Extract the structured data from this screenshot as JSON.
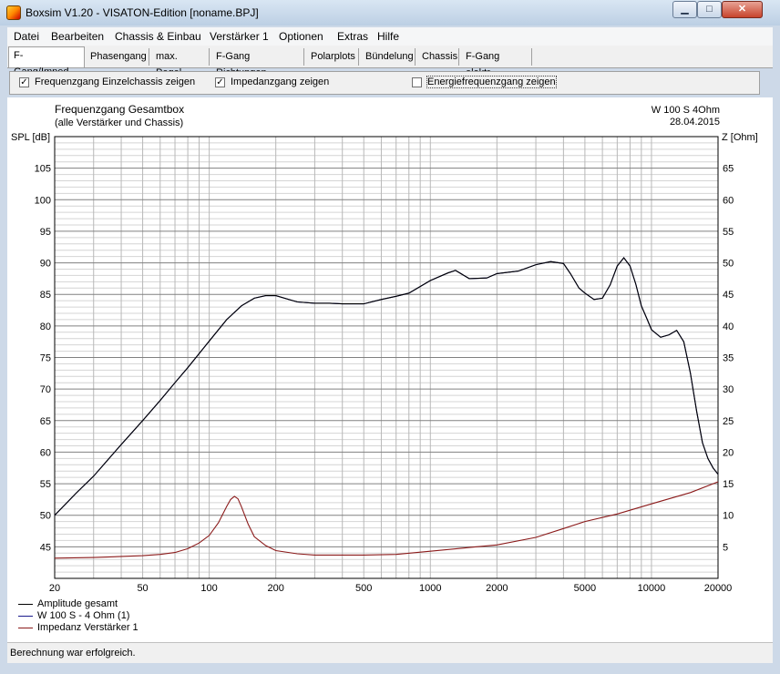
{
  "window": {
    "title": "Boxsim V1.20 - VISATON-Edition [noname.BPJ]"
  },
  "menu": [
    "Datei",
    "Bearbeiten",
    "Chassis & Einbau",
    "Verstärker 1",
    "Optionen",
    "Extras",
    "Hilfe"
  ],
  "tabs": [
    "F-Gang/Imped.",
    "Phasengang",
    "max. Pegel",
    "F-Gang Richtungen",
    "Polarplots",
    "Bündelung",
    "Chassis",
    "F-Gang elektr."
  ],
  "options": [
    {
      "label": "Frequenzgang Einzelchassis zeigen",
      "checked": true
    },
    {
      "label": "Impedanzgang zeigen",
      "checked": true
    },
    {
      "label": "Energiefrequenzgang zeigen",
      "checked": false
    }
  ],
  "status": "Berechnung war erfolgreich.",
  "colors": {
    "amplitude": "#000000",
    "chassis": "#1a1a8c",
    "impedance": "#8b1a1a"
  },
  "chart_data": {
    "type": "line",
    "title": "Frequenzgang Gesamtbox",
    "subtitle": "(alle Verstärker und Chassis)",
    "model": "W 100 S 4Ohm",
    "date": "28.04.2015",
    "ylabel": "SPL [dB]",
    "y2label": "Z [Ohm]",
    "xscale": "log",
    "xlim": [
      20,
      20000
    ],
    "ylim": [
      40,
      110
    ],
    "y2lim": [
      0,
      70
    ],
    "x_ticks": [
      "20",
      "50",
      "100",
      "200",
      "500",
      "1000",
      "2000",
      "5000",
      "10000",
      "20000"
    ],
    "y_ticks": [
      "45",
      "50",
      "55",
      "60",
      "65",
      "70",
      "75",
      "80",
      "85",
      "90",
      "95",
      "100",
      "105"
    ],
    "y2_ticks": [
      "5",
      "10",
      "15",
      "20",
      "25",
      "30",
      "35",
      "40",
      "45",
      "50",
      "55",
      "60",
      "65"
    ],
    "grid": true,
    "legend": "bottom-left",
    "series": [
      {
        "name": "Amplitude gesamt",
        "axis": "left",
        "x": [
          20,
          25,
          30,
          40,
          50,
          60,
          70,
          80,
          100,
          120,
          140,
          160,
          180,
          200,
          250,
          300,
          350,
          400,
          500,
          600,
          700,
          800,
          1000,
          1200,
          1300,
          1500,
          1800,
          2000,
          2500,
          3000,
          3500,
          4000,
          4300,
          4700,
          5000,
          5500,
          6000,
          6500,
          7000,
          7500,
          8000,
          8500,
          9000,
          9500,
          10000,
          11000,
          12000,
          13000,
          14000,
          15000,
          16000,
          17000,
          18000,
          19000,
          20000
        ],
        "y": [
          50,
          53.5,
          56.2,
          61.2,
          65,
          68.2,
          71,
          73.4,
          77.6,
          81,
          83.2,
          84.4,
          84.8,
          84.8,
          83.8,
          83.6,
          83.6,
          83.5,
          83.5,
          84.2,
          84.7,
          85.2,
          87.2,
          88.4,
          88.8,
          87.5,
          87.6,
          88.3,
          88.7,
          89.7,
          90.2,
          89.9,
          88.3,
          86,
          85.2,
          84.2,
          84.4,
          86.5,
          89.5,
          90.8,
          89.5,
          86.6,
          83.2,
          81.3,
          79.4,
          78.2,
          78.6,
          79.3,
          77.5,
          72.5,
          66.5,
          61.5,
          59,
          57.5,
          56.5
        ]
      },
      {
        "name": "W 100 S - 4 Ohm (1)",
        "axis": "left",
        "x": [
          20,
          25,
          30,
          40,
          50,
          60,
          70,
          80,
          100,
          120,
          140,
          160,
          180,
          200,
          250,
          300,
          350,
          400,
          500,
          600,
          700,
          800,
          1000,
          1200,
          1300,
          1500,
          1800,
          2000,
          2500,
          3000,
          3500,
          4000,
          4300,
          4700,
          5000,
          5500,
          6000,
          6500,
          7000,
          7500,
          8000,
          8500,
          9000,
          9500,
          10000,
          11000,
          12000,
          13000,
          14000,
          15000,
          16000,
          17000,
          18000,
          19000,
          20000
        ],
        "y": [
          50,
          53.5,
          56.2,
          61.2,
          65,
          68.2,
          71,
          73.4,
          77.6,
          81,
          83.2,
          84.4,
          84.8,
          84.8,
          83.8,
          83.6,
          83.6,
          83.5,
          83.5,
          84.2,
          84.7,
          85.2,
          87.2,
          88.4,
          88.8,
          87.5,
          87.6,
          88.3,
          88.7,
          89.7,
          90.2,
          89.9,
          88.3,
          86,
          85.2,
          84.2,
          84.4,
          86.5,
          89.5,
          90.8,
          89.5,
          86.6,
          83.2,
          81.3,
          79.4,
          78.2,
          78.6,
          79.3,
          77.5,
          72.5,
          66.5,
          61.5,
          59,
          57.5,
          56.5
        ]
      },
      {
        "name": "Impedanz Verstärker 1",
        "axis": "right",
        "x": [
          20,
          30,
          50,
          60,
          70,
          80,
          90,
          100,
          110,
          120,
          125,
          130,
          135,
          140,
          150,
          160,
          180,
          200,
          250,
          300,
          400,
          500,
          700,
          1000,
          1500,
          2000,
          3000,
          4000,
          5000,
          7000,
          10000,
          15000,
          20000
        ],
        "y": [
          3.2,
          3.3,
          3.6,
          3.8,
          4.1,
          4.7,
          5.6,
          6.8,
          8.8,
          11.4,
          12.5,
          13,
          12.6,
          11.3,
          8.6,
          6.6,
          5.2,
          4.4,
          3.9,
          3.7,
          3.7,
          3.7,
          3.8,
          4.3,
          4.9,
          5.3,
          6.5,
          7.9,
          9,
          10.2,
          11.8,
          13.6,
          15.3
        ]
      }
    ]
  }
}
